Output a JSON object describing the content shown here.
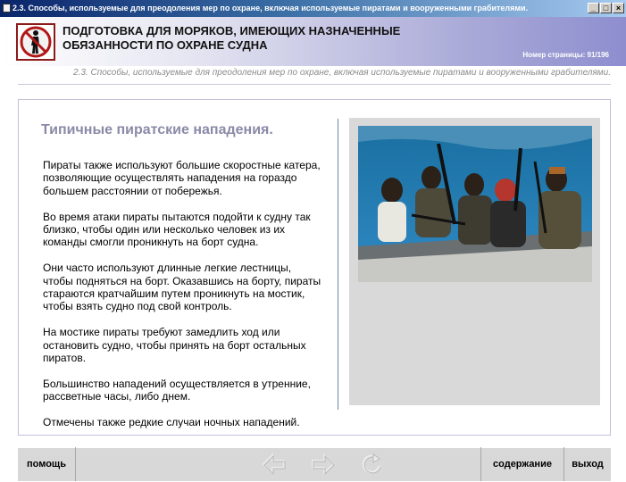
{
  "window": {
    "title": "2.3. Способы, используемые для преодоления мер по охране, включая используемые пиратами и вооруженными грабителями.",
    "buttons": [
      "_",
      "□",
      "×"
    ]
  },
  "header": {
    "title_line1": "ПОДГОТОВКА ДЛЯ МОРЯКОВ, ИМЕЮЩИХ НАЗНАЧЕННЫЕ",
    "title_line2": "ОБЯЗАННОСТИ ПО ОХРАНЕ СУДНА",
    "page_number": "Номер страницы: 91/196",
    "logo_icon": "no-entry-person-icon"
  },
  "subtitle": "2.3. Способы, используемые для преодоления мер по охране, включая используемые пиратами и вооруженными грабителями.",
  "content": {
    "heading": "Типичные пиратские нападения.",
    "paragraphs": [
      "Пираты также используют большие скоростные катера, позволяющие осуществлять нападения на гораздо большем расстоянии от побережья.",
      "Во время атаки пираты пытаются подойти к судну так близко, чтобы один или несколько человек из их команды смогли проникнуть на борт судна.",
      "Они часто используют длинные легкие лестницы, чтобы подняться на борт. Оказавшись на борту, пираты стараются кратчайшим путем проникнуть на мостик, чтобы взять судно под свой контроль.",
      "На мостике пираты требуют замедлить ход или остановить судно, чтобы принять на борт остальных пиратов.",
      "Большинство нападений осуществляется в утренние, рассветные часы, либо днем.",
      "Отмечены также редкие случаи ночных нападений."
    ]
  },
  "nav": {
    "help": "помощь",
    "contents": "содержание",
    "exit": "выход",
    "back_icon": "arrow-left-icon",
    "forward_icon": "arrow-right-icon",
    "reload_icon": "reload-icon"
  },
  "colors": {
    "heading": "#8a8aa8",
    "header_gradient_end": "#8e8ecf",
    "logo_red": "#8b1a1a"
  }
}
